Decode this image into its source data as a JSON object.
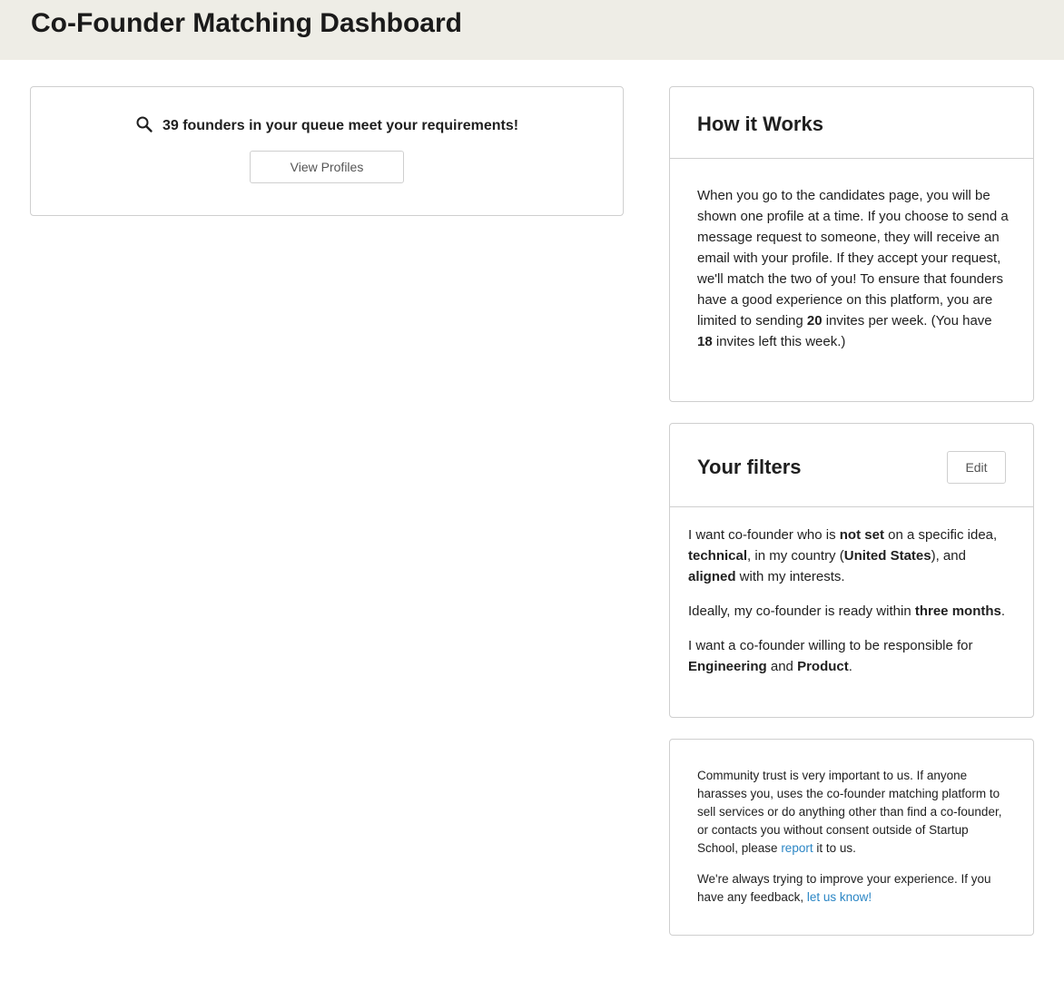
{
  "header": {
    "title": "Co-Founder Matching Dashboard"
  },
  "queue": {
    "count": "39",
    "message": "founders in your queue meet your requirements!",
    "button_label": "View Profiles",
    "icon": "search-icon"
  },
  "how_it_works": {
    "title": "How it Works",
    "text_before_limit": "When you go to the candidates page, you will be shown one profile at a time. If you choose to send a message request to someone, they will receive an email with your profile. If they accept your request, we'll match the two of you! To ensure that founders have a good experience on this platform, you are limited to sending ",
    "invite_limit": "20",
    "text_mid": " invites per week. (You have ",
    "invites_left": "18",
    "text_after": " invites left this week.)"
  },
  "filters": {
    "title": "Your filters",
    "edit_label": "Edit",
    "p1": {
      "t1": "I want co-founder who is ",
      "idea_status": "not set",
      "t2": " on a specific idea, ",
      "technical": "technical",
      "t3": ", in my country (",
      "country": "United States",
      "t4": "), and ",
      "interests": "aligned",
      "t5": " with my interests."
    },
    "p2": {
      "t1": "Ideally, my co-founder is ready within ",
      "timeline": "three months",
      "t2": "."
    },
    "p3": {
      "t1": "I want a co-founder willing to be responsible for ",
      "area1": "Engineering",
      "t2": " and ",
      "area2": "Product",
      "t3": "."
    }
  },
  "trust": {
    "p1_before": "Community trust is very important to us. If anyone harasses you, uses the co-founder matching platform to sell services or do anything other than find a co-founder, or contacts you without consent outside of Startup School, please ",
    "report_link": "report",
    "p1_after": " it to us.",
    "p2_before": "We're always trying to improve your experience. If you have any feedback, ",
    "feedback_link": "let us know!"
  },
  "colors": {
    "header_bg": "#eeede6",
    "link": "#2b86c5",
    "border": "#cfcfcf"
  }
}
